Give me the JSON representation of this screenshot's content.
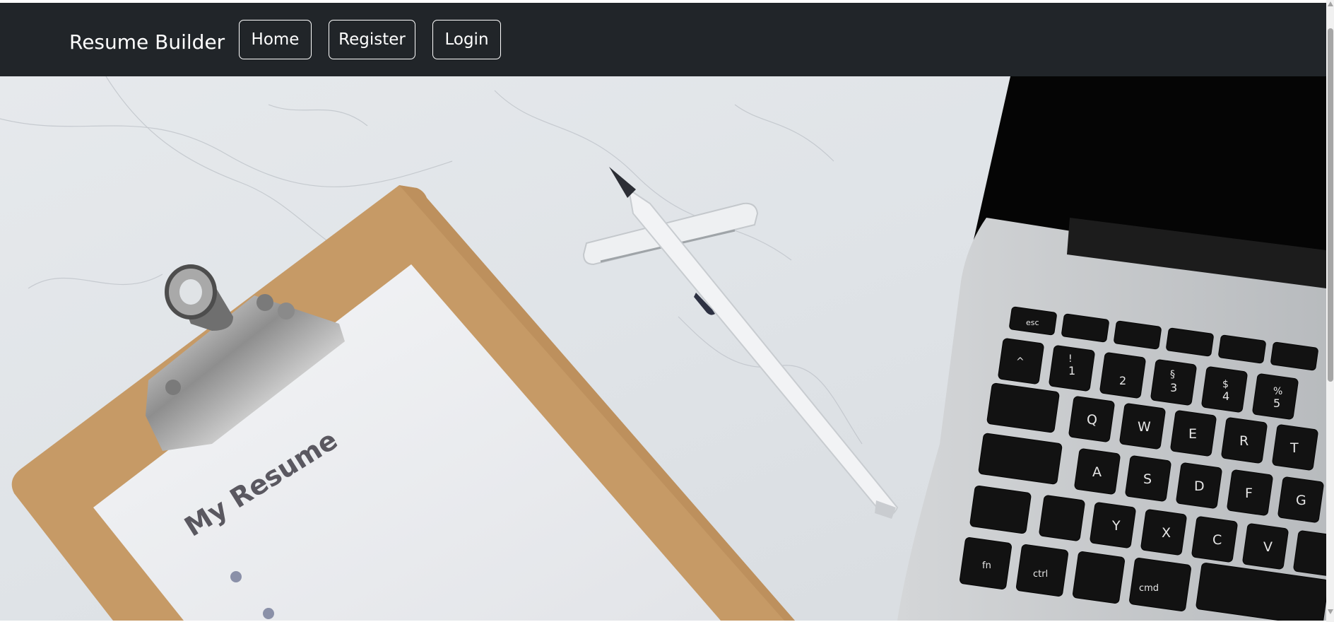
{
  "navbar": {
    "brand": "Resume Builder",
    "links": [
      {
        "label": "Home"
      },
      {
        "label": "Register"
      },
      {
        "label": "Login"
      }
    ]
  },
  "hero": {
    "image": "desk-clipboard-pen-laptop-photo",
    "paper_heading": "My Resume",
    "keyboard_keys": [
      "esc",
      "^",
      "!",
      "1",
      "2",
      "§",
      "3",
      "$",
      "4",
      "%",
      "5",
      "Q",
      "W",
      "E",
      "R",
      "T",
      "A",
      "S",
      "D",
      "F",
      "G",
      "Y",
      "X",
      "C",
      "V",
      "fn",
      "ctrl",
      "cmd"
    ]
  },
  "colors": {
    "navbar_bg": "#212529",
    "nav_text": "#ffffff"
  }
}
